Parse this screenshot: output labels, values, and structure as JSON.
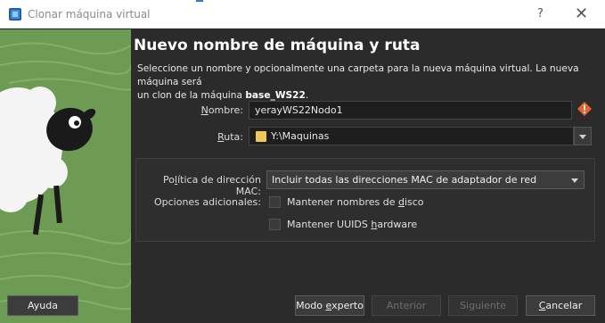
{
  "window": {
    "title": "Clonar máquina virtual",
    "help_label": "?",
    "close_label": "✕"
  },
  "page": {
    "heading": "Nuevo nombre de máquina y ruta",
    "description_line1": "Seleccione un nombre y opcionalmente una carpeta para la nueva máquina virtual. La nueva máquina será",
    "description_line2_prefix": "un clon de la máquina ",
    "source_vm": "base_WS22",
    "description_line2_suffix": "."
  },
  "form": {
    "name_label_u": "N",
    "name_label_rest": "ombre:",
    "name_value": "yerayWS22Nodo1",
    "path_label_u": "R",
    "path_label_rest": "uta:",
    "path_value": "Y:\\Maquinas"
  },
  "options": {
    "mac_label_pre": "Po",
    "mac_label_u": "l",
    "mac_label_rest": "ítica de dirección MAC:",
    "mac_selected": "Incluir todas las direcciones MAC de adaptador de red",
    "additional_label": "Opciones adicionales:",
    "keep_disk_pre": "Mantener nombres de ",
    "keep_disk_u": "d",
    "keep_disk_rest": "isco",
    "keep_uuid_pre": "Mantener UUIDS ",
    "keep_uuid_u": "h",
    "keep_uuid_rest": "ardware"
  },
  "buttons": {
    "help": "Ayuda",
    "expert_pre": "Modo ",
    "expert_u": "e",
    "expert_rest": "xperto",
    "back": "Anterior",
    "next": "Siguiente",
    "cancel_u": "C",
    "cancel_rest": "ancelar"
  },
  "colors": {
    "background": "#2b2b2b",
    "art_green": "#6d9b54",
    "warning": "#e8622c",
    "folder": "#f0c85a"
  }
}
